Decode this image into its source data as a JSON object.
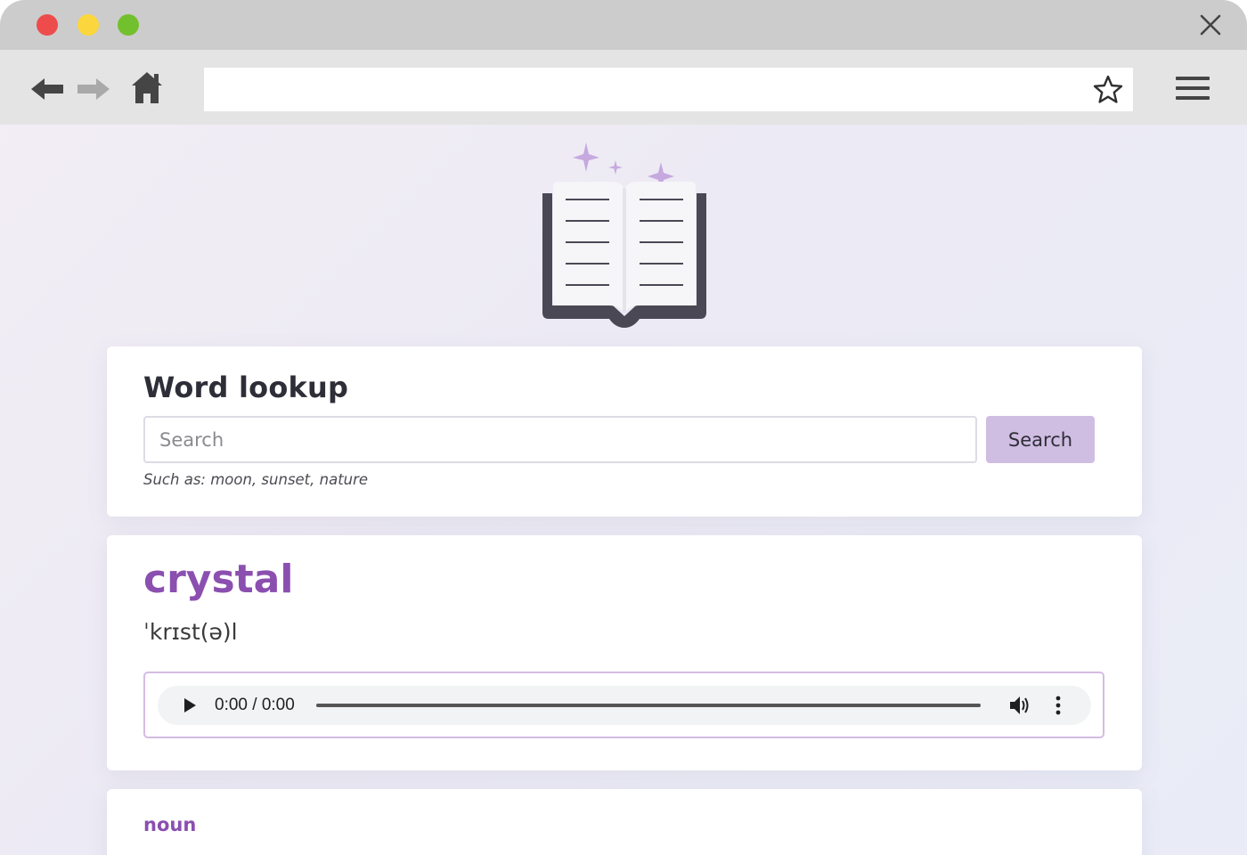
{
  "browser": {
    "url": "",
    "icons": {
      "back": "arrow-left-icon",
      "forward": "arrow-right-icon",
      "home": "home-icon",
      "bookmark": "star-icon",
      "menu": "hamburger-menu-icon",
      "close": "close-icon"
    },
    "colors": {
      "traffic_red": "#ee4c4c",
      "traffic_yellow": "#fcd63d",
      "traffic_green": "#73c02e"
    }
  },
  "hero": {
    "icon": "open-book-sparkles-icon"
  },
  "lookup": {
    "title": "Word lookup",
    "search_placeholder": "Search",
    "search_value": "",
    "search_button": "Search",
    "hint": "Such as: moon, sunset, nature"
  },
  "result": {
    "word": "crystal",
    "phonetic": "ˈkrɪst(ə)l",
    "audio": {
      "time": "0:00 / 0:00"
    }
  },
  "definition": {
    "part_of_speech": "noun",
    "text": ""
  },
  "colors": {
    "accent": "#8b4fb0",
    "button": "#d0bde2",
    "audio_border": "#d4bce3"
  }
}
